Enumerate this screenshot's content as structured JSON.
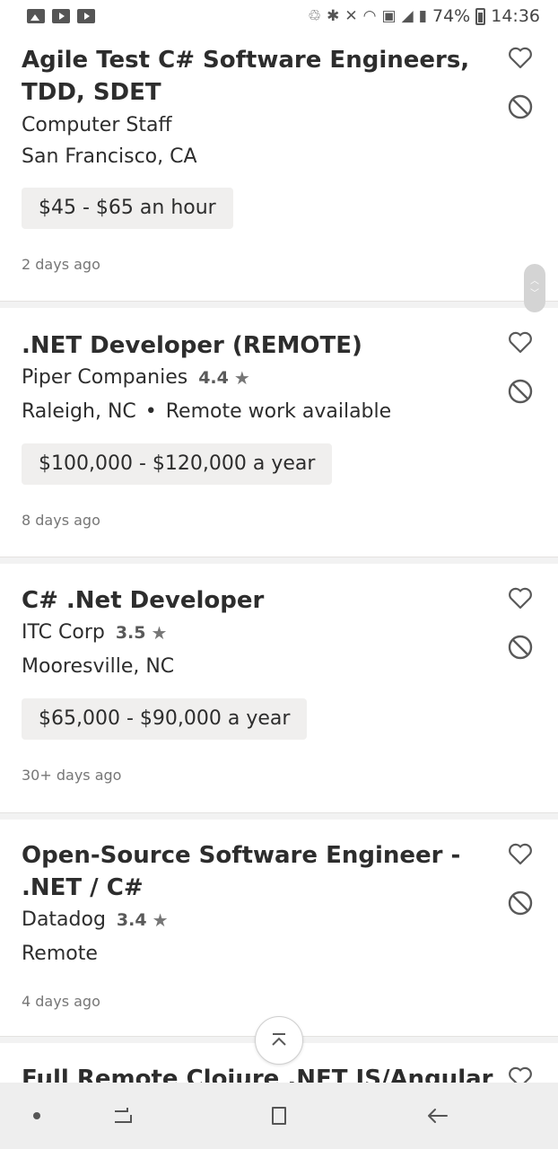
{
  "status_bar": {
    "left_icons": [
      "gallery-icon",
      "youtube-icon",
      "youtube-icon"
    ],
    "right_icons": [
      "data-saver-icon",
      "bluetooth-icon",
      "mute-icon",
      "wifi-icon",
      "sim-1-icon",
      "signal-icon",
      "signal-icon",
      "battery-icon"
    ],
    "battery": "74%",
    "time": "14:36"
  },
  "jobs": [
    {
      "title": "Agile Test C# Software Engineers, TDD, SDET",
      "company": "Computer Staff",
      "location": "San Francisco, CA",
      "salary": "$45 - $65 an hour",
      "posted": "2 days ago"
    },
    {
      "title": ".NET Developer (REMOTE)",
      "company": "Piper Companies",
      "rating": "4.4",
      "location": "Raleigh, NC",
      "remote": "Remote work available",
      "salary": "$100,000 - $120,000 a year",
      "posted": "8 days ago"
    },
    {
      "title": "C# .Net Developer",
      "company": "ITC Corp",
      "rating": "3.5",
      "location": "Mooresville, NC",
      "salary": "$65,000 - $90,000 a year",
      "posted": "30+ days ago"
    },
    {
      "title": "Open-Source Software Engineer - .NET / C#",
      "company": "Datadog",
      "rating": "3.4",
      "location": "Remote",
      "posted": "4 days ago"
    },
    {
      "title": "Full Remote Clojure .NET JS/Angular"
    }
  ],
  "icons": {
    "save": "heart-icon",
    "hide": "block-icon",
    "star": "star-icon",
    "back_to_top": "chevron-up-icon"
  },
  "nav_bar": {
    "items": [
      "dot-icon",
      "recent-apps-icon",
      "home-icon",
      "back-icon"
    ]
  },
  "colors": {
    "text": "#2d2d2d",
    "muted": "#767676",
    "salary_bg": "#f0efee",
    "nav_bg": "#eeeeee"
  }
}
